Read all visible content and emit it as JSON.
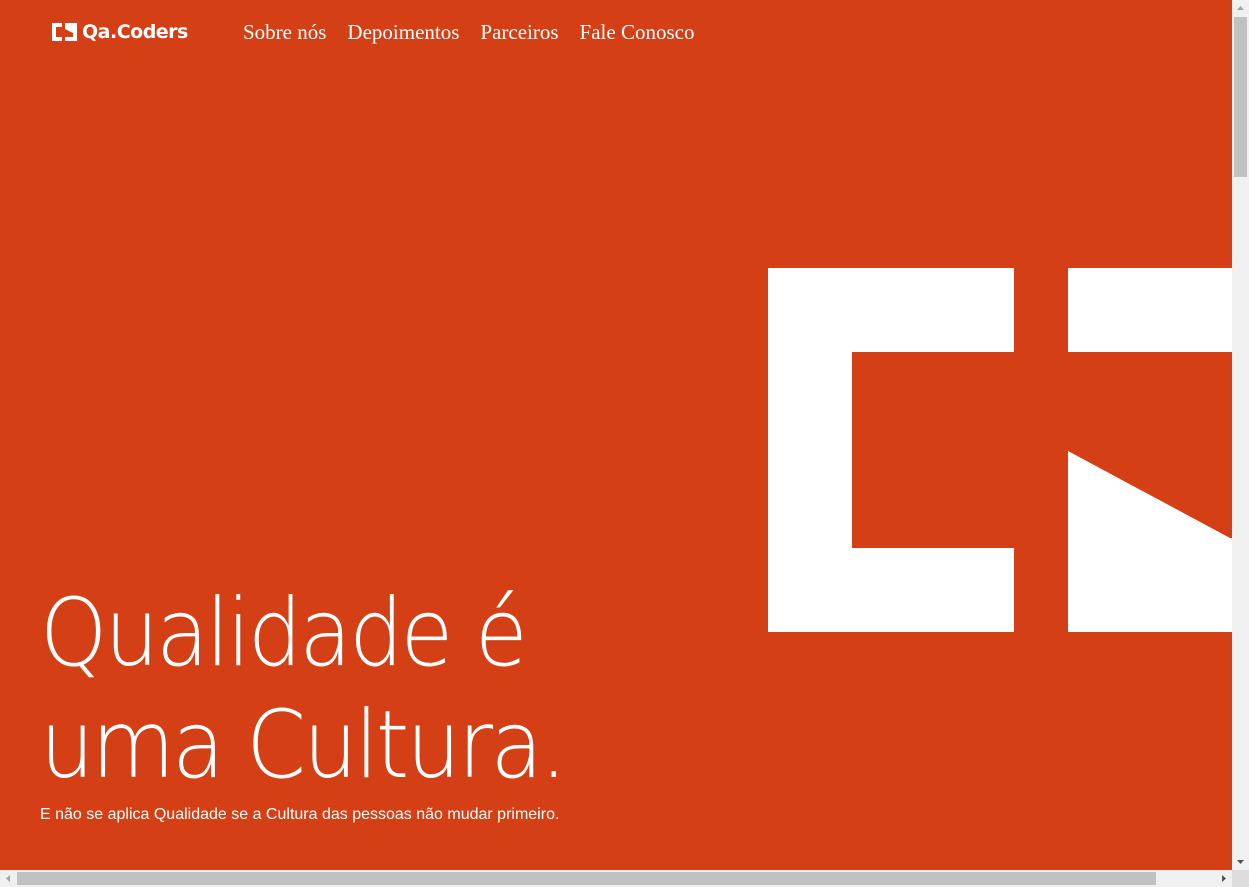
{
  "brand": {
    "logo_text": "Qa.Coders",
    "logo_icon": "qa-coders-bracket-logo",
    "accent_color": "#d53f16",
    "foreground_color": "#ffffff"
  },
  "nav": {
    "items": [
      {
        "label": "Sobre nós"
      },
      {
        "label": "Depoimentos"
      },
      {
        "label": "Parceiros"
      },
      {
        "label": "Fale Conosco"
      }
    ]
  },
  "hero": {
    "title_line1": "Qualidade é",
    "title_line2": "uma Cultura.",
    "subtitle": "E não se aplica Qualidade se a Cultura das pessoas não mudar primeiro.",
    "graphic_icon": "large-bracket-logo-graphic"
  },
  "scrollbars": {
    "vertical_position": 0.0,
    "horizontal_visible_fraction": 0.93
  }
}
